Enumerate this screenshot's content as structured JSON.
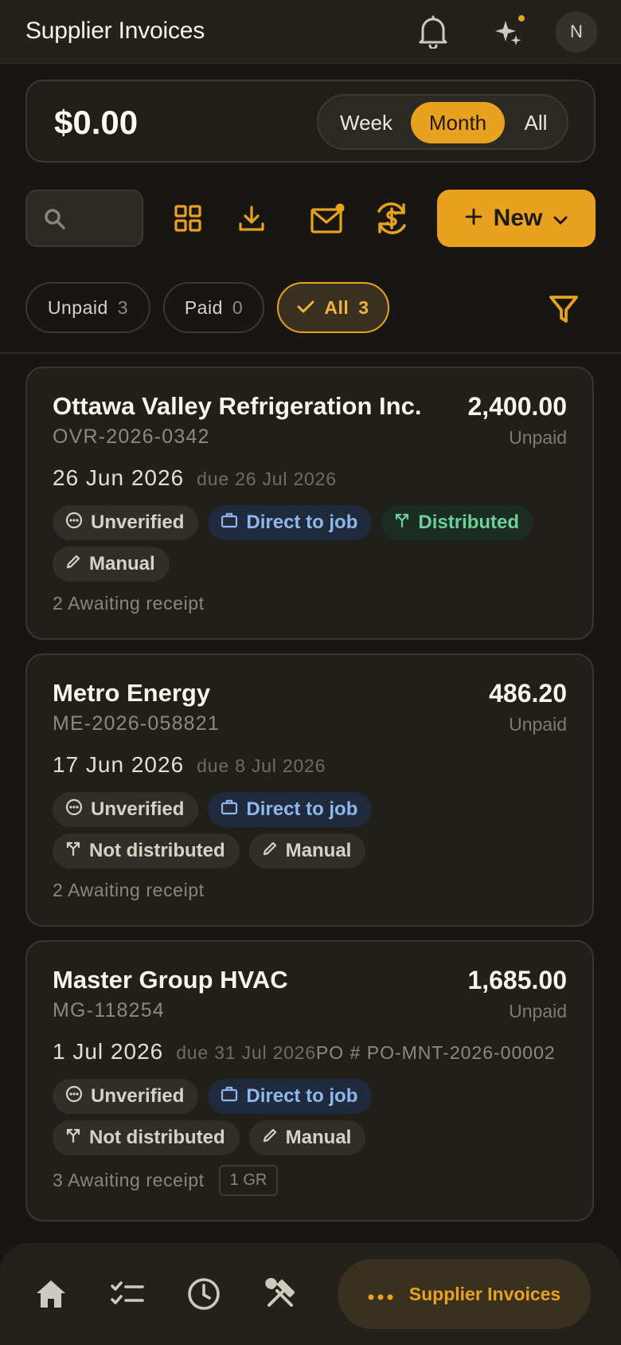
{
  "header": {
    "title": "Supplier Invoices",
    "avatar_initial": "N"
  },
  "summary": {
    "amount": "$0.00",
    "periods": [
      "Week",
      "Month",
      "All"
    ],
    "selected_period": "Month"
  },
  "toolbar": {
    "search_placeholder": "",
    "new_label": "New"
  },
  "filters": {
    "chips": [
      {
        "label": "Unpaid",
        "count": "3"
      },
      {
        "label": "Paid",
        "count": "0"
      },
      {
        "label": "All",
        "count": "3"
      }
    ],
    "active": "All"
  },
  "invoices": [
    {
      "supplier": "Ottawa Valley Refrigeration Inc.",
      "number": "OVR-2026-0342",
      "amount": "2,400.00",
      "status": "Unpaid",
      "date": "26 Jun 2026",
      "due": "due 26 Jul 2026",
      "po": "",
      "tags": [
        "Unverified",
        "Direct to job",
        "Distributed",
        "Manual"
      ],
      "awaiting": "2 Awaiting receipt",
      "gr": ""
    },
    {
      "supplier": "Metro Energy",
      "number": "ME-2026-058821",
      "amount": "486.20",
      "status": "Unpaid",
      "date": "17 Jun 2026",
      "due": "due 8 Jul 2026",
      "po": "",
      "tags": [
        "Unverified",
        "Direct to job",
        "Not distributed",
        "Manual"
      ],
      "awaiting": "2 Awaiting receipt",
      "gr": ""
    },
    {
      "supplier": "Master Group HVAC",
      "number": "MG-118254",
      "amount": "1,685.00",
      "status": "Unpaid",
      "date": "1 Jul 2026",
      "due": "due 31 Jul 2026",
      "po": "PO # PO-MNT-2026-00002",
      "tags": [
        "Unverified",
        "Direct to job",
        "Not distributed",
        "Manual"
      ],
      "awaiting": "3 Awaiting receipt",
      "gr": "1 GR"
    }
  ],
  "bottom_nav": {
    "items": [
      "home-icon",
      "checklist-icon",
      "clock-icon",
      "tools-icon"
    ],
    "active_label": "Supplier Invoices"
  },
  "colors": {
    "accent": "#e9a120",
    "background": "#171612",
    "card": "#201f1a",
    "blue_tag": "#8fb7ec",
    "green_tag": "#6fcf97"
  }
}
